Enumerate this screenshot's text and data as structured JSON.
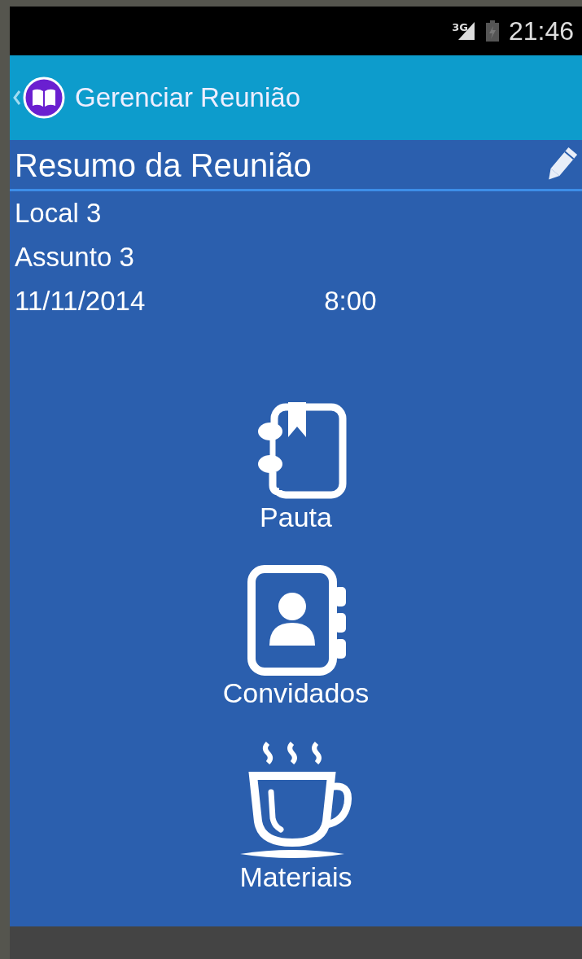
{
  "status_bar": {
    "network": "3G",
    "time": "21:46"
  },
  "action_bar": {
    "title": "Gerenciar Reunião"
  },
  "summary": {
    "title": "Resumo da Reunião",
    "location": "Local 3",
    "subject": "Assunto 3",
    "date": "11/11/2014",
    "time": "8:00"
  },
  "menu": [
    {
      "kind": "notebook",
      "label": "Pauta"
    },
    {
      "kind": "contacts",
      "label": "Convidados"
    },
    {
      "kind": "cup",
      "label": "Materiais"
    }
  ]
}
